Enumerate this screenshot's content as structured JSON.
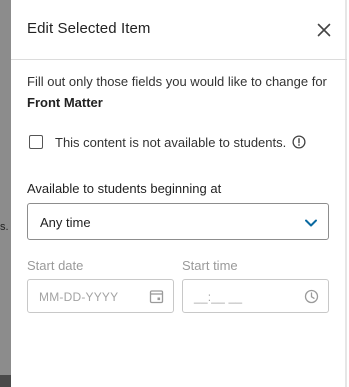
{
  "backdrop": {
    "fragment_text": "s."
  },
  "dialog": {
    "title": "Edit Selected Item",
    "close_icon": "close-icon",
    "intro_text": "Fill out only those fields you would like to change for",
    "item_name": "Front Matter"
  },
  "visibility": {
    "checkbox_checked": false,
    "checkbox_label": "This content is not available to students.",
    "info_icon": "info-circle-icon"
  },
  "availability": {
    "section_label": "Available to students beginning at",
    "selected_option": "Any time",
    "chevron_icon": "chevron-down-icon",
    "start_date": {
      "label": "Start date",
      "placeholder": "MM-DD-YYYY",
      "icon": "calendar-icon"
    },
    "start_time": {
      "label": "Start time",
      "placeholder": "__:__ __",
      "icon": "clock-icon"
    }
  },
  "colors": {
    "accent": "#0a6aa1",
    "border": "#8d8d8d",
    "disabled_text": "#9a9a9a"
  }
}
